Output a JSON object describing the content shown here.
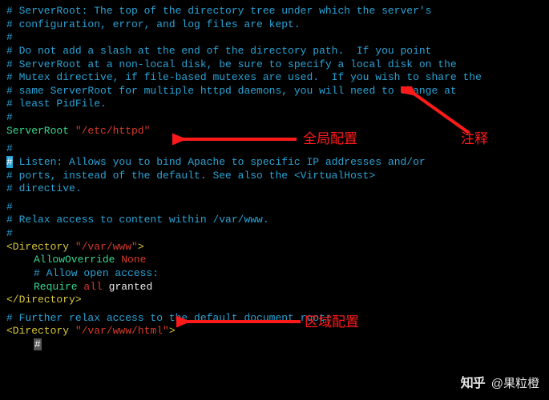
{
  "code": {
    "block1": [
      "# ServerRoot: The top of the directory tree under which the server's",
      "# configuration, error, and log files are kept.",
      "#",
      "# Do not add a slash at the end of the directory path.  If you point",
      "# ServerRoot at a non-local disk, be sure to specify a local disk on the",
      "# Mutex directive, if file-based mutexes are used.  If you wish to share the",
      "# same ServerRoot for multiple httpd daemons, you will need to change at",
      "# least PidFile.",
      "#"
    ],
    "serverroot": {
      "directive": "ServerRoot",
      "value": "\"/etc/httpd\""
    },
    "block2_hash": "#",
    "block2_listen": " Listen: Allows you to bind Apache to specific IP addresses and/or",
    "block2_rest": [
      "# ports, instead of the default. See also the <VirtualHost>",
      "# directive."
    ],
    "block3": [
      "#",
      "# Relax access to content within /var/www.",
      "#"
    ],
    "dirOpen1": {
      "tag": "<Directory ",
      "path": "\"/var/www\"",
      "close": ">"
    },
    "allowOverride": {
      "key": "AllowOverride",
      "val": "None"
    },
    "openAccess": "# Allow open access:",
    "require": {
      "key": "Require",
      "mid": "all",
      "end": "granted"
    },
    "dirClose": "</Directory>",
    "block4": [
      "# Further relax access to the default document root:"
    ],
    "dirOpen2": {
      "tag": "<Directory ",
      "path": "\"/var/www/html\"",
      "close": ">"
    },
    "tailHash": "#"
  },
  "annotations": {
    "global": "全局配置",
    "comment": "注释",
    "region": "区域配置"
  },
  "watermark": {
    "logo": "知乎",
    "author": "@果粒橙"
  }
}
